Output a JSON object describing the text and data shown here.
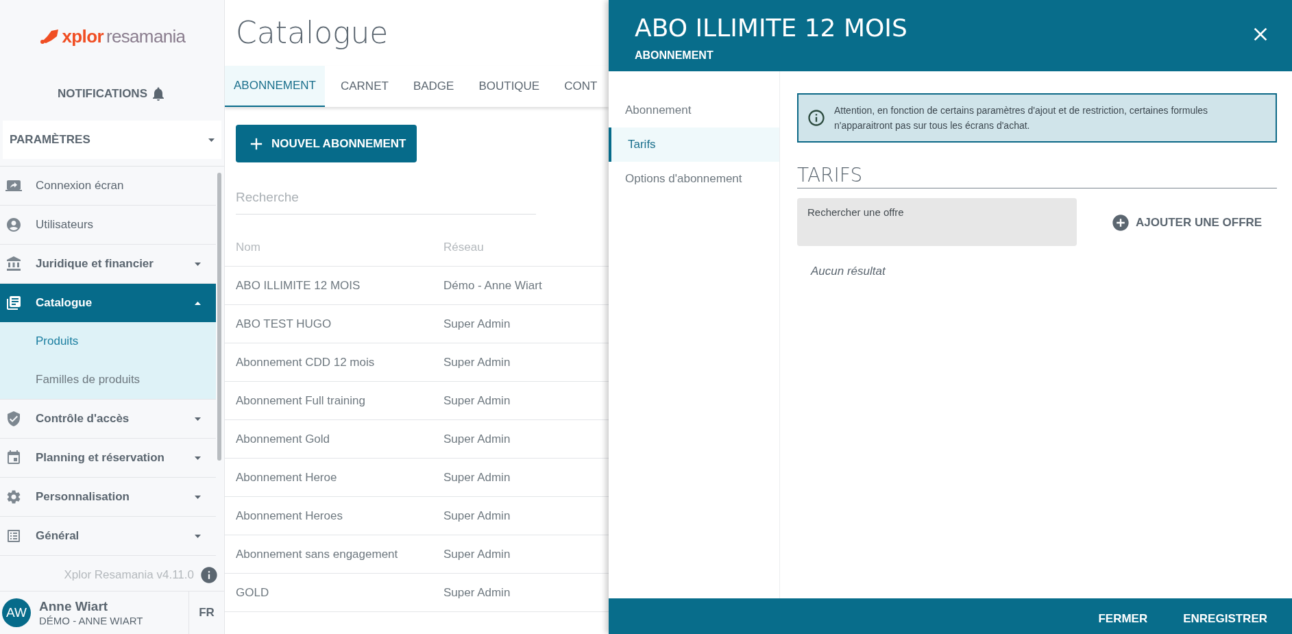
{
  "sidebar": {
    "logo": {
      "brand": "xplor",
      "product": "resamania"
    },
    "notifications": "NOTIFICATIONS",
    "section_select": "PARAMÈTRES",
    "items": [
      {
        "kind": "link",
        "label": "Connexion écran",
        "selected": false
      },
      {
        "kind": "link",
        "label": "Utilisateurs",
        "selected": false
      },
      {
        "kind": "group",
        "label": "Juridique et financier",
        "expanded": false,
        "selected": false
      },
      {
        "kind": "group",
        "label": "Catalogue",
        "expanded": true,
        "selected": true,
        "children": [
          {
            "label": "Produits",
            "selected": true
          },
          {
            "label": "Familles de produits",
            "selected": false
          }
        ]
      },
      {
        "kind": "group",
        "label": "Contrôle d'accès",
        "expanded": false,
        "selected": false
      },
      {
        "kind": "group",
        "label": "Planning et réservation",
        "expanded": false,
        "selected": false
      },
      {
        "kind": "group",
        "label": "Personnalisation",
        "expanded": false,
        "selected": false
      },
      {
        "kind": "group",
        "label": "Général",
        "expanded": false,
        "selected": false
      }
    ],
    "version": "Xplor Resamania v4.11.0",
    "user": {
      "initials": "AW",
      "name": "Anne Wiart",
      "org": "DÉMO - ANNE WIART"
    },
    "language": "FR"
  },
  "main": {
    "title": "Catalogue",
    "tabs": [
      {
        "label": "ABONNEMENT",
        "selected": true
      },
      {
        "label": "CARNET",
        "selected": false
      },
      {
        "label": "BADGE",
        "selected": false
      },
      {
        "label": "BOUTIQUE",
        "selected": false
      },
      {
        "label": "CONT",
        "selected": false
      }
    ],
    "new_button": "NOUVEL ABONNEMENT",
    "search": {
      "placeholder": "Recherche"
    },
    "table": {
      "columns": [
        "Nom",
        "Réseau"
      ],
      "rows": [
        [
          "ABO ILLIMITE 12 MOIS",
          "Démo - Anne Wiart"
        ],
        [
          "ABO TEST HUGO",
          "Super Admin"
        ],
        [
          "Abonnement CDD 12 mois",
          "Super Admin"
        ],
        [
          "Abonnement Full training",
          "Super Admin"
        ],
        [
          "Abonnement Gold",
          "Super Admin"
        ],
        [
          "Abonnement Heroe",
          "Super Admin"
        ],
        [
          "Abonnement Heroes",
          "Super Admin"
        ],
        [
          "Abonnement sans engagement",
          "Super Admin"
        ],
        [
          "GOLD",
          "Super Admin"
        ]
      ]
    }
  },
  "drawer": {
    "title": "ABO ILLIMITE 12 MOIS",
    "subtitle": "ABONNEMENT",
    "nav": [
      {
        "label": "Abonnement",
        "selected": false
      },
      {
        "label": "Tarifs",
        "selected": true
      },
      {
        "label": "Options d'abonnement",
        "selected": false
      }
    ],
    "alert": "Attention, en fonction de certains paramètres d'ajout et de restriction, certaines formules n'apparaitront pas sur tous les écrans d'achat.",
    "section_title": "TARIFS",
    "offer_search": {
      "placeholder": "Rechercher une offre"
    },
    "add_button": "AJOUTER UNE OFFRE",
    "empty": "Aucun résultat",
    "footer_buttons": [
      "FERMER",
      "ENREGISTRER"
    ]
  }
}
